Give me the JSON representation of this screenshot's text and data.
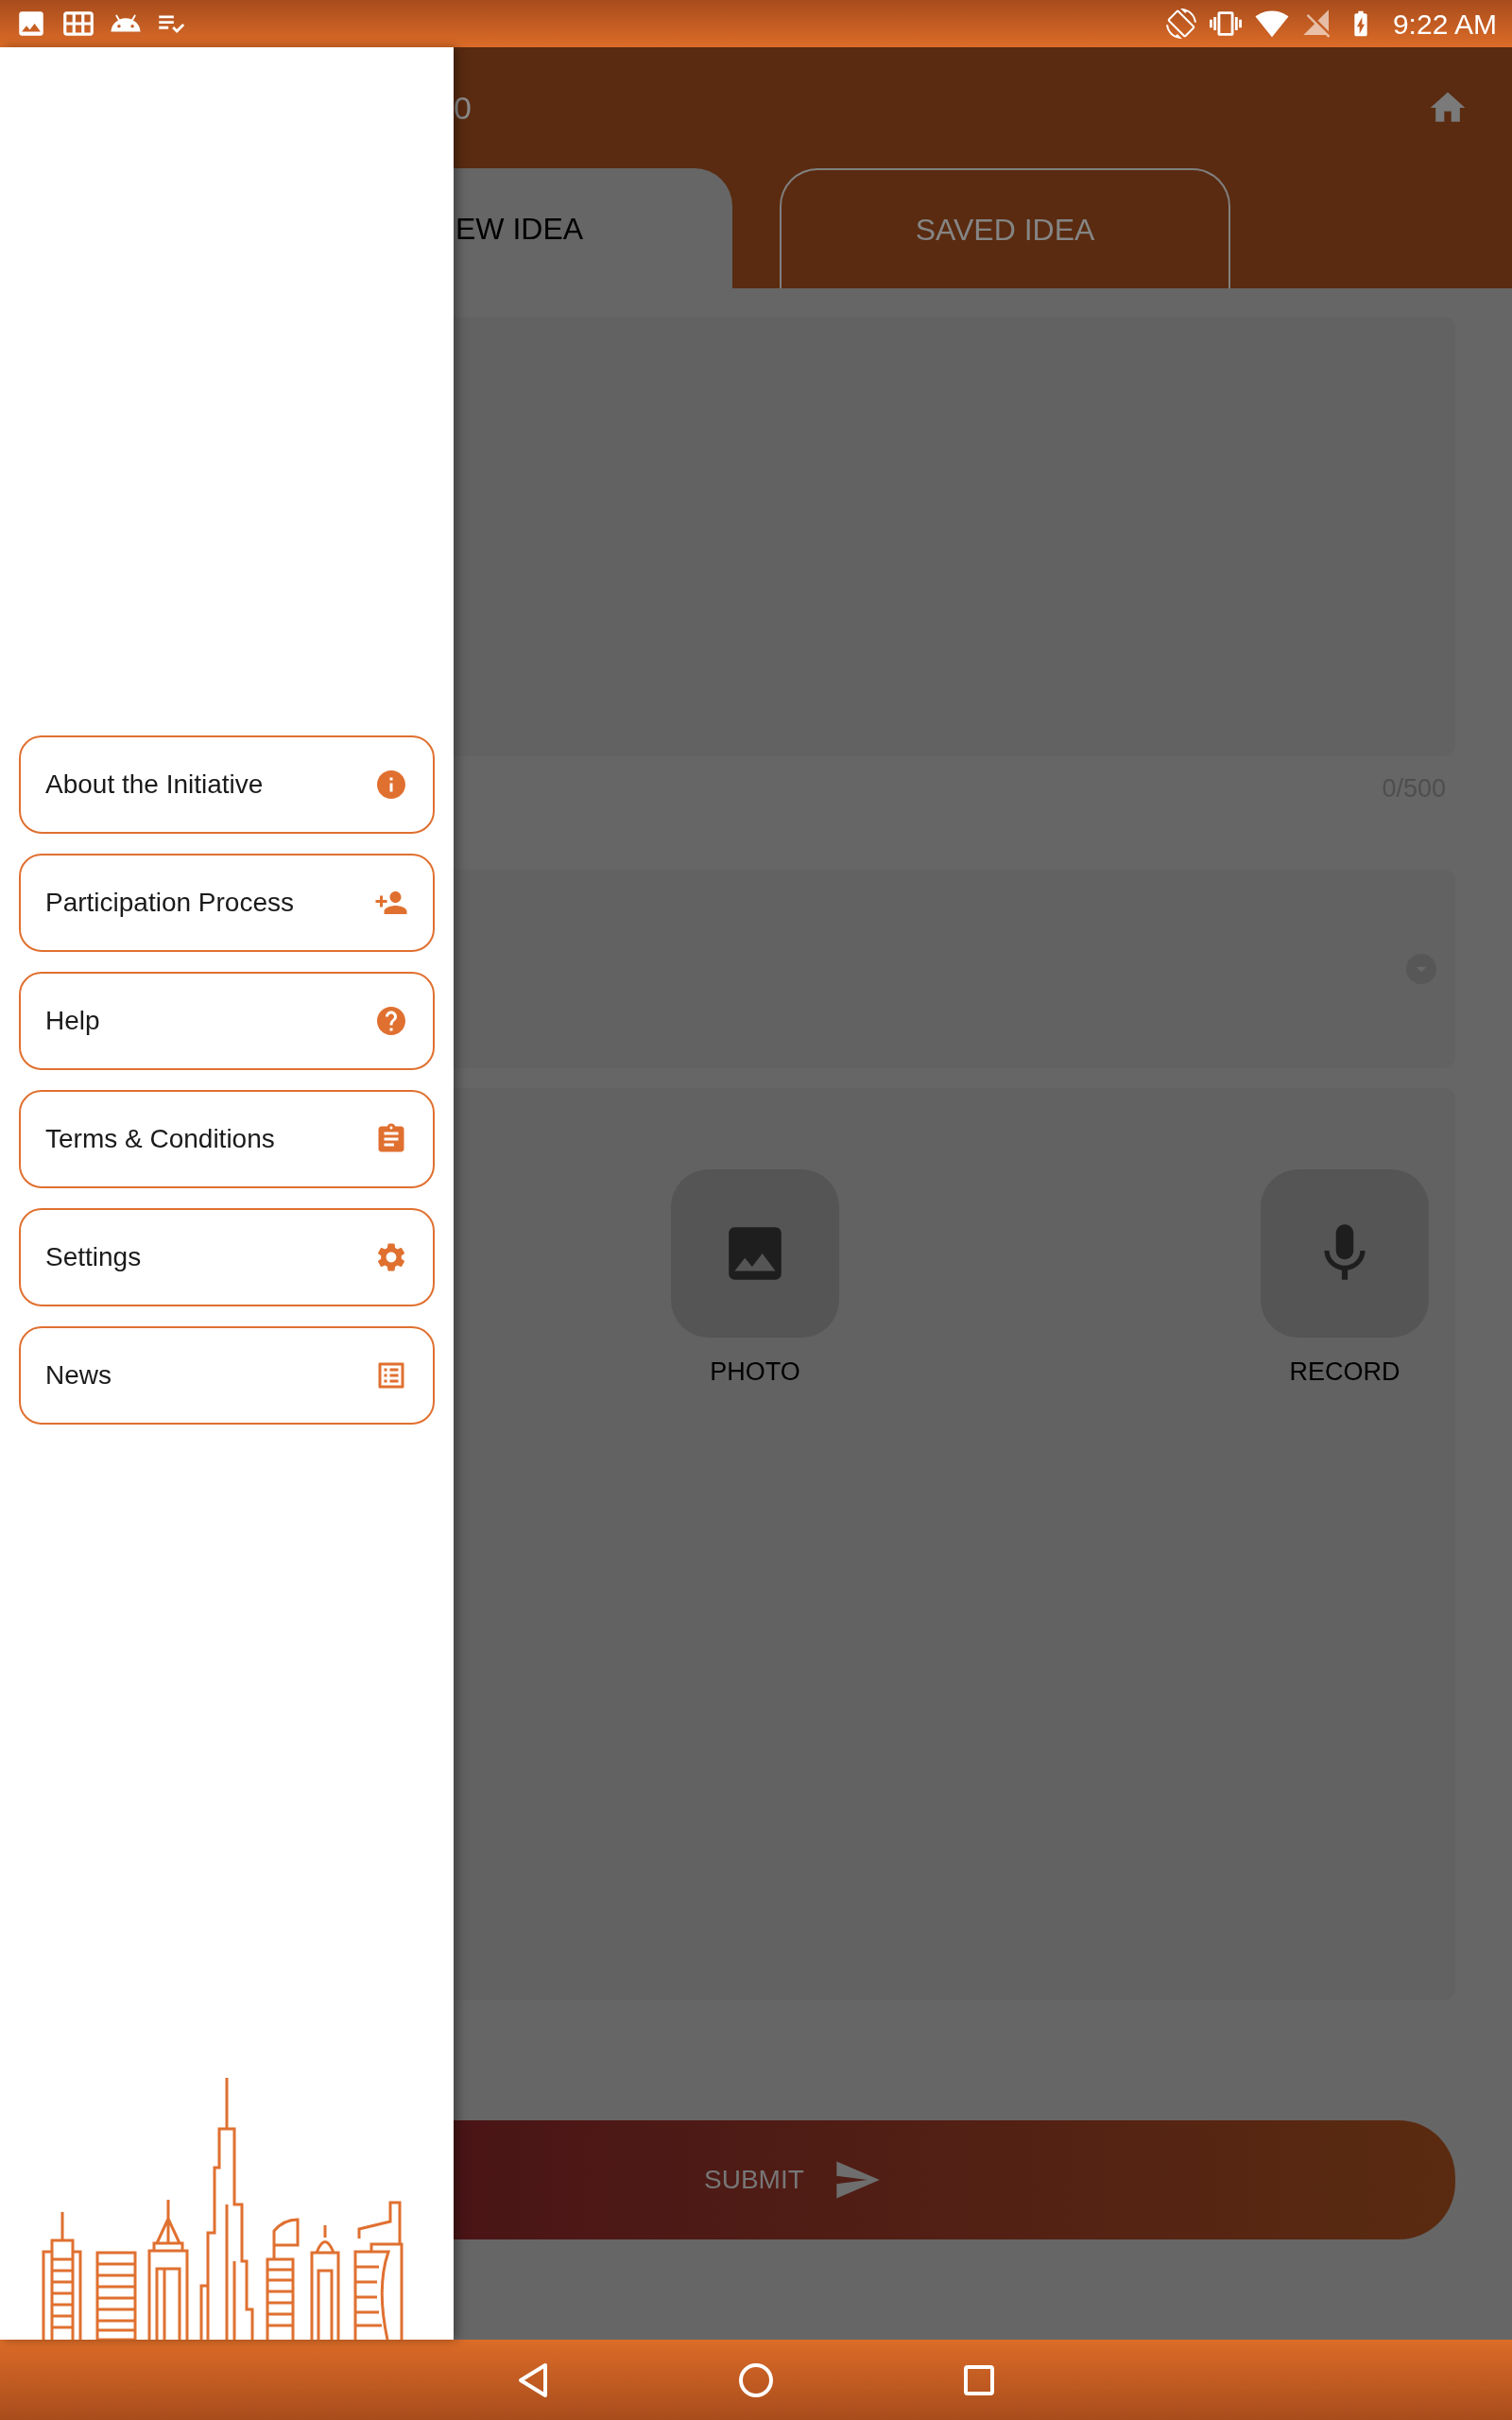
{
  "status_bar": {
    "time": "9:22 AM"
  },
  "drawer": {
    "menu": [
      {
        "label": "About the Initiative",
        "kind": "info"
      },
      {
        "label": "Participation Process",
        "kind": "person-add"
      },
      {
        "label": "Help",
        "kind": "help"
      },
      {
        "label": "Terms & Conditions",
        "kind": "clipboard"
      },
      {
        "label": "Settings",
        "kind": "settings"
      },
      {
        "label": "News",
        "kind": "list"
      }
    ]
  },
  "header": {
    "title": "0"
  },
  "tabs": [
    {
      "label": "EW IDEA",
      "selected": true
    },
    {
      "label": "SAVED IDEA",
      "selected": false
    }
  ],
  "form": {
    "counter": "0/500",
    "attachments": [
      {
        "label": "PHOTO",
        "kind": "photo"
      },
      {
        "label": "RECORD",
        "kind": "record"
      }
    ],
    "submit": "SUBMIT"
  }
}
